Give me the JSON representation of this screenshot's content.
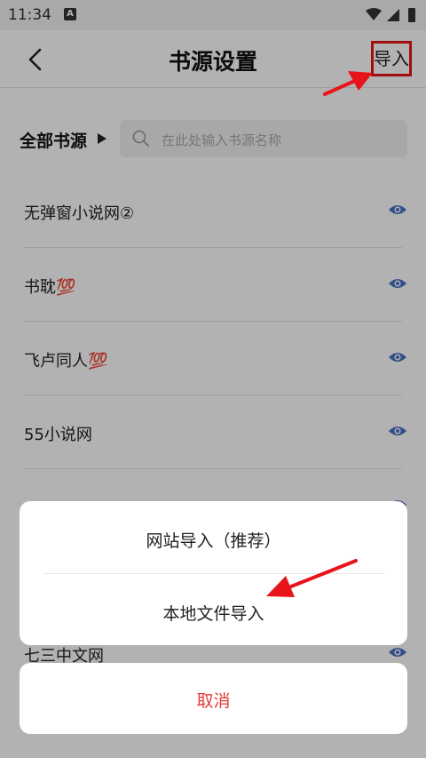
{
  "status": {
    "time": "11:34",
    "notif_badge": "A"
  },
  "header": {
    "title": "书源设置",
    "import_label": "导入"
  },
  "filter": {
    "label": "全部书源",
    "search_placeholder": "在此处输入书源名称"
  },
  "sources": [
    {
      "name": "无弹窗小说网②"
    },
    {
      "name": "书耽💯"
    },
    {
      "name": "飞卢同人💯"
    },
    {
      "name": "55小说网"
    },
    {
      "name": ""
    },
    {
      "name": ""
    },
    {
      "name": "七三中文网"
    }
  ],
  "sheet": {
    "option1": "网站导入（推荐）",
    "option2": "本地文件导入",
    "cancel": "取消"
  },
  "colors": {
    "accent": "#e8141b",
    "eye": "#4a72c4",
    "cancel": "#e53935"
  }
}
